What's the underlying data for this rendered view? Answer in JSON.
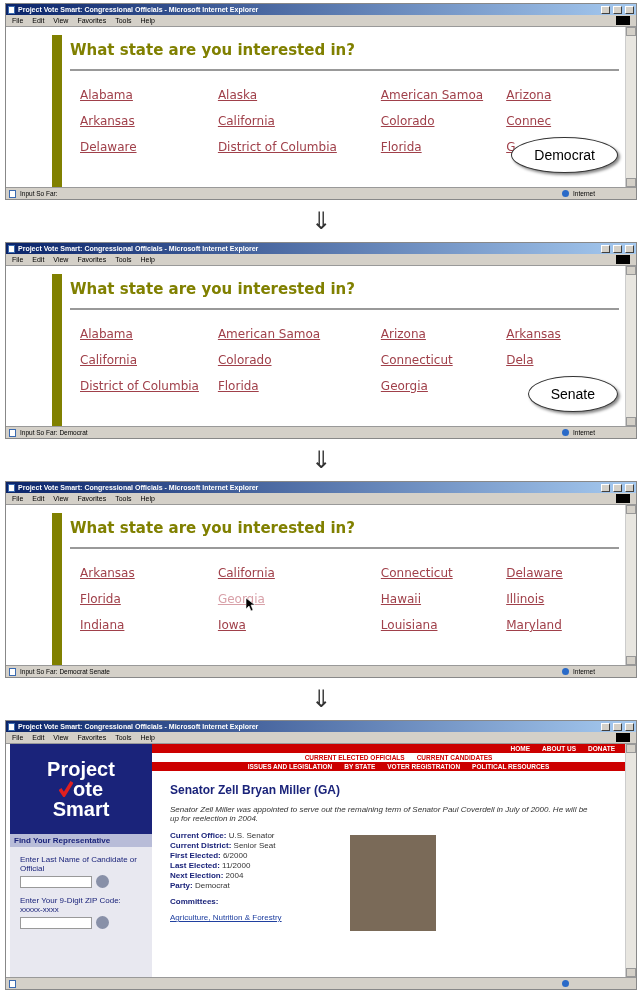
{
  "frames": [
    {
      "kind": "states",
      "title": "Project Vote Smart: Congressional Officials - Microsoft Internet Explorer",
      "menu": [
        "File",
        "Edit",
        "View",
        "Favorites",
        "Tools",
        "Help"
      ],
      "heading": "What state are you interested in?",
      "states": [
        {
          "name": "Alabama",
          "hovered": false
        },
        {
          "name": "Alaska",
          "hovered": false
        },
        {
          "name": "American Samoa",
          "hovered": false
        },
        {
          "name": "Arizona",
          "hovered": false
        },
        {
          "name": "Arkansas",
          "hovered": false
        },
        {
          "name": "California",
          "hovered": false
        },
        {
          "name": "Colorado",
          "hovered": false
        },
        {
          "name": "Connec",
          "hovered": false
        },
        {
          "name": "Delaware",
          "hovered": false
        },
        {
          "name": "District of Columbia",
          "hovered": false
        },
        {
          "name": "Florida",
          "hovered": false
        },
        {
          "name": "G",
          "hovered": false
        }
      ],
      "bubble": "Democrat",
      "status": "Input So Far:",
      "zone": "Internet"
    },
    {
      "kind": "states",
      "arrow": "⇓",
      "title": "Project Vote Smart: Congressional Officials - Microsoft Internet Explorer",
      "menu": [
        "File",
        "Edit",
        "View",
        "Favorites",
        "Tools",
        "Help"
      ],
      "heading": "What state are you interested in?",
      "states": [
        {
          "name": "Alabama",
          "hovered": false
        },
        {
          "name": "American Samoa",
          "hovered": false
        },
        {
          "name": "Arizona",
          "hovered": false
        },
        {
          "name": "Arkansas",
          "hovered": false
        },
        {
          "name": "California",
          "hovered": false
        },
        {
          "name": "Colorado",
          "hovered": false
        },
        {
          "name": "Connecticut",
          "hovered": false
        },
        {
          "name": "Dela",
          "hovered": false
        },
        {
          "name": "District of Columbia",
          "hovered": false
        },
        {
          "name": "Florida",
          "hovered": false
        },
        {
          "name": "Georgia",
          "hovered": false
        }
      ],
      "bubble": "Senate",
      "status": "Input So Far: Democrat",
      "zone": "Internet"
    },
    {
      "kind": "states",
      "arrow": "⇓",
      "title": "Project Vote Smart: Congressional Officials - Microsoft Internet Explorer",
      "menu": [
        "File",
        "Edit",
        "View",
        "Favorites",
        "Tools",
        "Help"
      ],
      "heading": "What state are you interested in?",
      "states": [
        {
          "name": "Arkansas",
          "hovered": false
        },
        {
          "name": "California",
          "hovered": false
        },
        {
          "name": "Connecticut",
          "hovered": false
        },
        {
          "name": "Delaware",
          "hovered": false
        },
        {
          "name": "Florida",
          "hovered": false
        },
        {
          "name": "Georgia",
          "hovered": true
        },
        {
          "name": "Hawaii",
          "hovered": false
        },
        {
          "name": "Illinois",
          "hovered": false
        },
        {
          "name": "Indiana",
          "hovered": false
        },
        {
          "name": "Iowa",
          "hovered": false
        },
        {
          "name": "Louisiana",
          "hovered": false
        },
        {
          "name": "Maryland",
          "hovered": false
        }
      ],
      "status": "Input So Far: Democrat Senate",
      "zone": "Internet"
    },
    {
      "kind": "profile",
      "arrow": "⇓",
      "title": "Project Vote Smart: Congressional Officials - Microsoft Internet Explorer",
      "menu": [
        "File",
        "Edit",
        "View",
        "Favorites",
        "Tools",
        "Help"
      ],
      "logo": [
        "Project",
        "ote",
        "Smart"
      ],
      "nav": [
        [
          "HOME",
          "ABOUT US",
          "DONATE"
        ],
        [
          "CURRENT ELECTED OFFICIALS",
          "CURRENT CANDIDATES"
        ],
        [
          "ISSUES AND LEGISLATION",
          "BY STATE",
          "VOTER REGISTRATION",
          "POLITICAL RESOURCES"
        ]
      ],
      "sidebar_title": "Find Your Representative",
      "search_labels": [
        "Enter Last Name of Candidate or Official",
        "Enter Your 9-Digit ZIP Code: xxxxx-xxxx"
      ],
      "heading": "Senator Zell Bryan Miller (GA)",
      "intro": "Senator Zell Miller was appointed to serve out the remaining term of Senator Paul Coverdell in July of 2000. He will be up for reelection in 2004.",
      "facts": [
        {
          "label": "Current Office:",
          "value": "U.S. Senator"
        },
        {
          "label": "Current District:",
          "value": "Senior Seat"
        },
        {
          "label": "First Elected:",
          "value": "6/2000"
        },
        {
          "label": "Last Elected:",
          "value": "11/2000"
        },
        {
          "label": "Next Election:",
          "value": "2004"
        },
        {
          "label": "Party:",
          "value": "Democrat"
        }
      ],
      "committees_label": "Committees:",
      "committees": [
        "Agriculture, Nutrition & Forestry"
      ]
    }
  ]
}
